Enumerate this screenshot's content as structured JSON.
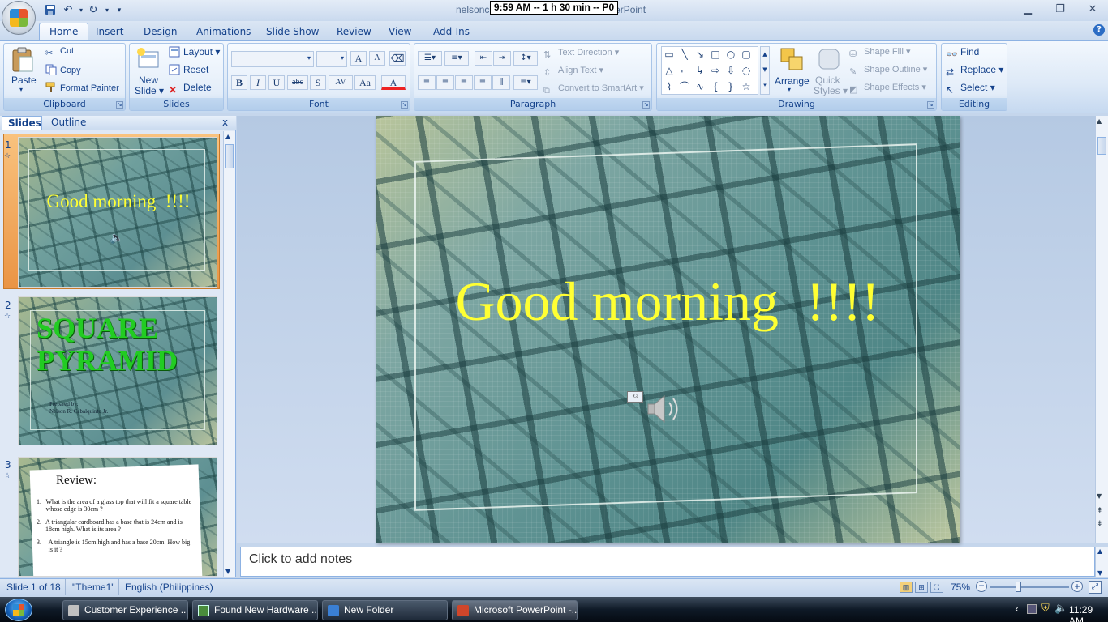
{
  "window": {
    "title_left": "nelsonc",
    "title_right": "werPoint",
    "timer_overlay": "9:59 AM  -- 1 h 30 min  -- P0"
  },
  "tabs": [
    "Home",
    "Insert",
    "Design",
    "Animations",
    "Slide Show",
    "Review",
    "View",
    "Add-Ins"
  ],
  "ribbon": {
    "clipboard": {
      "label": "Clipboard",
      "paste": "Paste",
      "cut": "Cut",
      "copy": "Copy",
      "format_painter": "Format Painter"
    },
    "slides": {
      "label": "Slides",
      "new_slide_1": "New",
      "new_slide_2": "Slide",
      "layout": "Layout",
      "reset": "Reset",
      "delete": "Delete"
    },
    "font": {
      "label": "Font",
      "bold": "B",
      "italic": "I",
      "underline": "U",
      "strike": "abc",
      "shadow": "S",
      "spacing": "AV",
      "case": "Aa",
      "color": "A",
      "grow": "A",
      "shrink": "A"
    },
    "paragraph": {
      "label": "Paragraph",
      "text_direction": "Text Direction",
      "align_text": "Align Text",
      "convert_smartart": "Convert to SmartArt"
    },
    "drawing": {
      "label": "Drawing",
      "arrange": "Arrange",
      "quick_styles_1": "Quick",
      "quick_styles_2": "Styles",
      "shape_fill": "Shape Fill",
      "shape_outline": "Shape Outline",
      "shape_effects": "Shape Effects"
    },
    "editing": {
      "label": "Editing",
      "find": "Find",
      "replace": "Replace",
      "select": "Select"
    }
  },
  "left_pane": {
    "tabs": [
      "Slides",
      "Outline"
    ],
    "close": "x",
    "slides": [
      {
        "number": "1",
        "title": "Good morning  !!!!"
      },
      {
        "number": "2",
        "title_line1": "SQUARE",
        "title_line2": "PYRAMID",
        "prepared_label": "Prepared by:",
        "author": "Nelson R. Cabalquinto Jr."
      },
      {
        "number": "3",
        "title": "Review:",
        "items": [
          "What is the area of a glass top that will fit a square table whose edge is 30cm ?",
          "A triangular cardboard has a base that is 24cm and is 18cm high. What is its area ?",
          "A triangle is 15cm high and has a base 20cm. How big is it ?"
        ]
      }
    ]
  },
  "slide": {
    "title": "Good morning  !!!!"
  },
  "notes": {
    "placeholder": "Click to add notes"
  },
  "status": {
    "slide_info": "Slide 1 of 18",
    "theme": "\"Theme1\"",
    "language": "English (Philippines)",
    "zoom": "75%"
  },
  "taskbar": {
    "tasks": [
      "Customer Experience ...",
      "Found New Hardware ...",
      "New Folder",
      "Microsoft PowerPoint -..."
    ],
    "clock": "11:29 AM"
  },
  "colors": {
    "slide_title": "#ffff33",
    "square_pyramid": "#22cc22",
    "ribbon_text": "#15428b"
  }
}
